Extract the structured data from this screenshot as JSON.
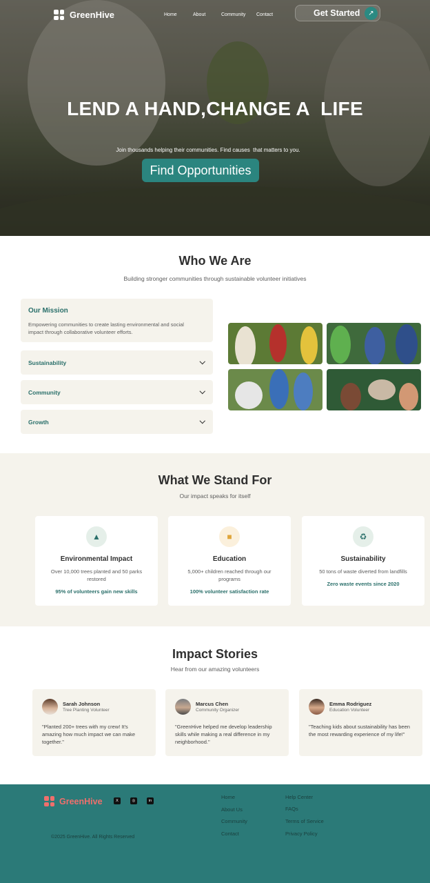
{
  "nav": {
    "brand": "GreenHive",
    "links": [
      "Home",
      "About",
      "Community",
      "Contact"
    ],
    "cta": "Get Started"
  },
  "hero": {
    "title": "LEND A HAND,CHANGE A  LIFE",
    "subtitle": "Join thousands helping their communities. Find causes  that matters to you.",
    "button": "Find Opportunities"
  },
  "who": {
    "title": "Who We Are",
    "subtitle": "Building stronger communities through sustainable volunteer initiatives",
    "mission_title": "Our Mission",
    "mission_text": "Empowering communities to create lasting environmental and social impact through collaborative volunteer efforts.",
    "accordion": [
      "Sustainability",
      "Community",
      "Growth"
    ]
  },
  "stand": {
    "title": "What We Stand For",
    "subtitle": "Our impact speaks for itself",
    "cards": [
      {
        "icon": "tree-icon",
        "title": "Environmental Impact",
        "desc": "Over 10,000 trees planted and 50 parks restored",
        "stat": "95% of volunteers gain new skills"
      },
      {
        "icon": "book-icon",
        "title": "Education",
        "desc": "5,000+ children reached through our programs",
        "stat": "100% volunteer satisfaction rate"
      },
      {
        "icon": "recycle-icon",
        "title": "Sustainability",
        "desc": "50 tons of waste diverted from landfills",
        "stat": "Zero waste events since 2020"
      }
    ]
  },
  "stories": {
    "title": "Impact Stories",
    "subtitle": "Hear from our amazing volunteers",
    "items": [
      {
        "name": "Sarah Johnson",
        "role": "Tree Planting Volunteer",
        "quote": "\"Planted 200+ trees with my crew! It's amazing how much impact we can make together.\""
      },
      {
        "name": "Marcus Chen",
        "role": "Community Organizer",
        "quote": "\"GreenHive helped me develop leadership skills while making a real difference in my neighborhood.\""
      },
      {
        "name": "Emma Rodriguez",
        "role": "Education Volunteer",
        "quote": "\"Teaching kids about sustainability has been the most rewarding experience of my life!\""
      }
    ]
  },
  "footer": {
    "brand": "GreenHive",
    "social": [
      "X",
      "◎",
      "in"
    ],
    "col1": [
      "Home",
      "About Us",
      "Community",
      "Contact"
    ],
    "col2": [
      "Help Center",
      "FAQs",
      "Terms of Service",
      "Privacy Policy"
    ],
    "copyright": "©2025 GreenHive. All Rights Reserved"
  },
  "colors": {
    "accent": "#2b857f",
    "brand_footer": "#ef6f6c",
    "footer_bg": "#2b7a78",
    "panel": "#f5f3ec"
  }
}
